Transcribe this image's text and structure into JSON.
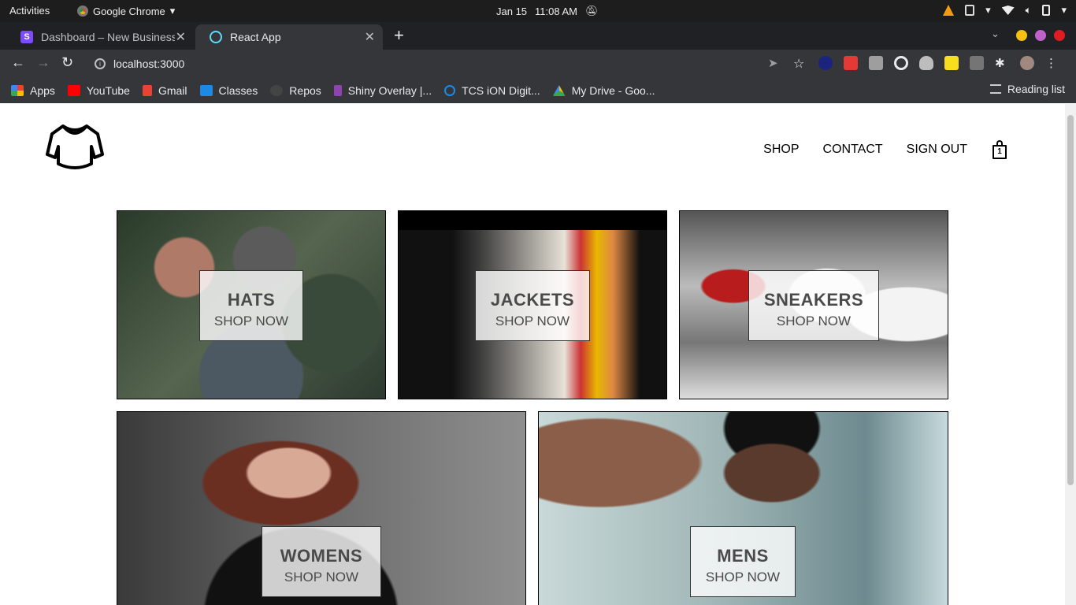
{
  "os_bar": {
    "activities": "Activities",
    "app_menu": "Google Chrome",
    "date": "Jan 15",
    "time": "11:08 AM"
  },
  "browser": {
    "tabs": [
      {
        "title": "Dashboard – New Business",
        "favicon": "stripe-s-icon"
      },
      {
        "title": "React App",
        "favicon": "react-icon"
      }
    ],
    "url": "localhost:3000",
    "bookmarks": [
      {
        "label": "Apps",
        "icon": "apps-grid-icon",
        "color": "#4285f4"
      },
      {
        "label": "YouTube",
        "icon": "youtube-icon",
        "color": "#ff0000"
      },
      {
        "label": "Gmail",
        "icon": "gmail-icon",
        "color": "#ea4335"
      },
      {
        "label": "Classes",
        "icon": "classroom-icon",
        "color": "#1e88e5"
      },
      {
        "label": "Repos",
        "icon": "github-icon",
        "color": "#444444"
      },
      {
        "label": "Shiny Overlay |...",
        "icon": "overlay-icon",
        "color": "#8e44ad"
      },
      {
        "label": "TCS iON Digit...",
        "icon": "power-icon",
        "color": "#1e88e5"
      },
      {
        "label": "My Drive - Goo...",
        "icon": "drive-icon",
        "color": "#fbbc04"
      }
    ],
    "reading_list": "Reading list"
  },
  "header": {
    "nav": [
      "SHOP",
      "CONTACT",
      "SIGN OUT"
    ],
    "cart_count": "1"
  },
  "directory": [
    {
      "title": "HATS",
      "subtitle": "SHOP NOW"
    },
    {
      "title": "JACKETS",
      "subtitle": "SHOP NOW"
    },
    {
      "title": "SNEAKERS",
      "subtitle": "SHOP NOW"
    },
    {
      "title": "WOMENS",
      "subtitle": "SHOP NOW"
    },
    {
      "title": "MENS",
      "subtitle": "SHOP NOW"
    }
  ]
}
